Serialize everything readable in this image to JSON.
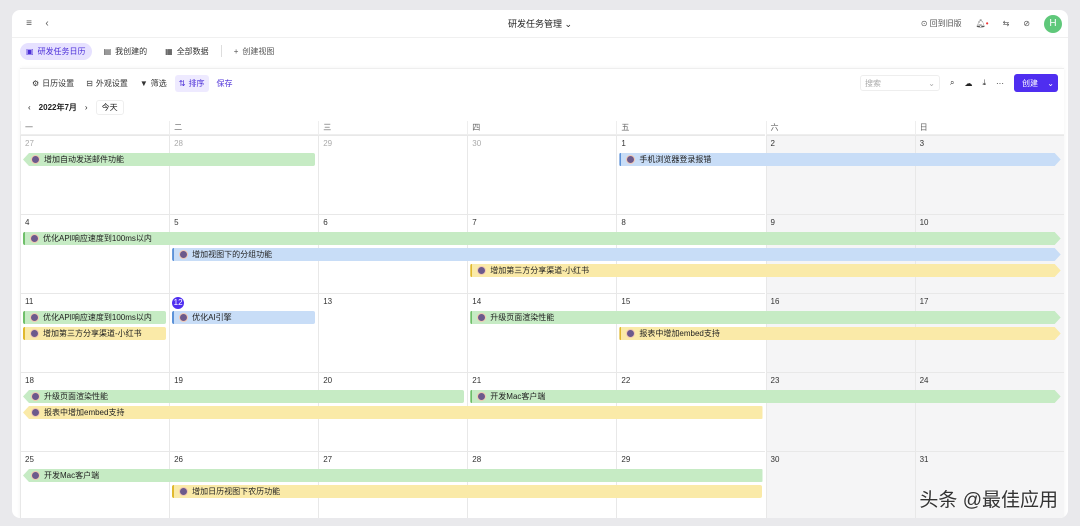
{
  "header": {
    "title": "研发任务管理",
    "back_old": "回到旧版",
    "avatar": "H"
  },
  "views": [
    {
      "label": "研发任务日历",
      "active": true
    },
    {
      "label": "我创建的"
    },
    {
      "label": "全部数据"
    }
  ],
  "create_view": "创建视图",
  "toolbar": {
    "calendar_settings": "日历设置",
    "appearance": "外观设置",
    "filter": "筛选",
    "sort": "排序",
    "save": "保存",
    "search_placeholder": "搜索",
    "create": "创建"
  },
  "nav": {
    "month": "2022年7月",
    "today": "今天"
  },
  "weekdays": [
    "一",
    "二",
    "三",
    "四",
    "五",
    "六",
    "日"
  ],
  "weeks": [
    [
      "27",
      "28",
      "29",
      "30",
      "1",
      "2",
      "3"
    ],
    [
      "4",
      "5",
      "6",
      "7",
      "8",
      "9",
      "10"
    ],
    [
      "11",
      "12",
      "13",
      "14",
      "15",
      "16",
      "17"
    ],
    [
      "18",
      "19",
      "20",
      "21",
      "22",
      "23",
      "24"
    ],
    [
      "25",
      "26",
      "27",
      "28",
      "29",
      "30",
      "31"
    ]
  ],
  "today": "12",
  "colors": {
    "green": "#c6ebc4",
    "blue": "#c8ddf7",
    "yellow": "#faeaa8",
    "accent": "#4f2ef0"
  },
  "events": [
    {
      "week": 0,
      "start": 0,
      "end": 1,
      "lane": 0,
      "color": "green",
      "title": "增加自动发送邮件功能",
      "cont_left": true
    },
    {
      "week": 0,
      "start": 4,
      "end": 6,
      "lane": 0,
      "color": "blue",
      "title": "手机浏览器登录报错",
      "cont_right": true
    },
    {
      "week": 1,
      "start": 0,
      "end": 6,
      "lane": 0,
      "color": "green",
      "title": "优化API响应速度到100ms以内",
      "cont_right": true
    },
    {
      "week": 1,
      "start": 1,
      "end": 6,
      "lane": 1,
      "color": "blue",
      "title": "增加视图下的分组功能",
      "cont_right": true
    },
    {
      "week": 1,
      "start": 3,
      "end": 6,
      "lane": 2,
      "color": "yellow",
      "title": "增加第三方分享渠道-小红书",
      "cont_right": true
    },
    {
      "week": 2,
      "start": 0,
      "end": 0,
      "lane": 0,
      "color": "green",
      "title": "优化API响应速度到100ms以内"
    },
    {
      "week": 2,
      "start": 0,
      "end": 0,
      "lane": 1,
      "color": "yellow",
      "title": "增加第三方分享渠道-小红书"
    },
    {
      "week": 2,
      "start": 1,
      "end": 1,
      "lane": 0,
      "color": "blue",
      "title": "优化AI引擎"
    },
    {
      "week": 2,
      "start": 3,
      "end": 6,
      "lane": 0,
      "color": "green",
      "title": "升级页面渲染性能",
      "cont_right": true
    },
    {
      "week": 2,
      "start": 4,
      "end": 6,
      "lane": 1,
      "color": "yellow",
      "title": "报表中增加embed支持",
      "cont_right": true
    },
    {
      "week": 3,
      "start": 0,
      "end": 2,
      "lane": 0,
      "color": "green",
      "title": "升级页面渲染性能",
      "cont_left": true
    },
    {
      "week": 3,
      "start": 3,
      "end": 6,
      "lane": 0,
      "color": "green",
      "title": "开发Mac客户端",
      "cont_right": true
    },
    {
      "week": 3,
      "start": 0,
      "end": 4,
      "lane": 1,
      "color": "yellow",
      "title": "报表中增加embed支持",
      "cont_left": true
    },
    {
      "week": 4,
      "start": 0,
      "end": 4,
      "lane": 0,
      "color": "green",
      "title": "开发Mac客户端",
      "cont_left": true
    },
    {
      "week": 4,
      "start": 1,
      "end": 4,
      "lane": 1,
      "color": "yellow",
      "title": "增加日历视图下农历功能"
    }
  ],
  "watermark": "头条 @最佳应用"
}
